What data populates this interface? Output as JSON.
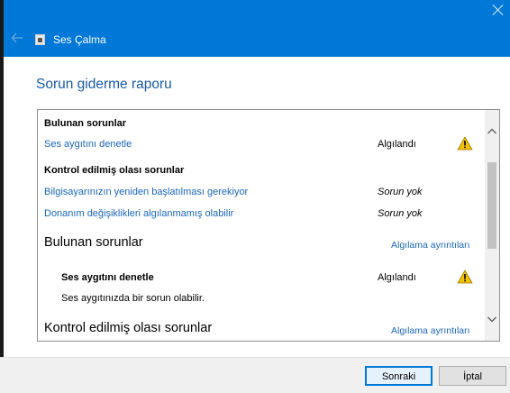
{
  "window": {
    "title": "Ses Çalma",
    "icons": {
      "back": "back-arrow-icon",
      "close": "close-icon",
      "app": "speaker-troubleshooter-icon"
    }
  },
  "heading": "Sorun giderme raporu",
  "summary": {
    "found_title": "Bulunan sorunlar",
    "found_items": [
      {
        "label": "Ses aygıtını denetle",
        "status": "Algılandı",
        "icon": "warning-icon"
      }
    ],
    "checked_title": "Kontrol edilmiş olası sorunlar",
    "checked_items": [
      {
        "label": "Bilgisayarınızın yeniden başlatılması gerekiyor",
        "status": "Sorun yok"
      },
      {
        "label": "Donanım değişiklikleri algılanmamış olabilir",
        "status": "Sorun yok"
      }
    ]
  },
  "details": {
    "found_title": "Bulunan sorunlar",
    "found_link": "Algılama ayrıntıları",
    "item_title": "Ses aygıtını denetle",
    "item_status": "Algılandı",
    "item_desc": "Ses aygıtınızda bir sorun olabilir.",
    "checked_title": "Kontrol edilmiş olası sorunlar",
    "checked_link": "Algılama ayrıntıları"
  },
  "buttons": {
    "next": "Sonraki",
    "cancel": "İptal"
  },
  "colors": {
    "titlebar": "#0078d7",
    "link": "#1a66b8",
    "heading": "#1a5aa6",
    "warning": "#f2c200"
  }
}
